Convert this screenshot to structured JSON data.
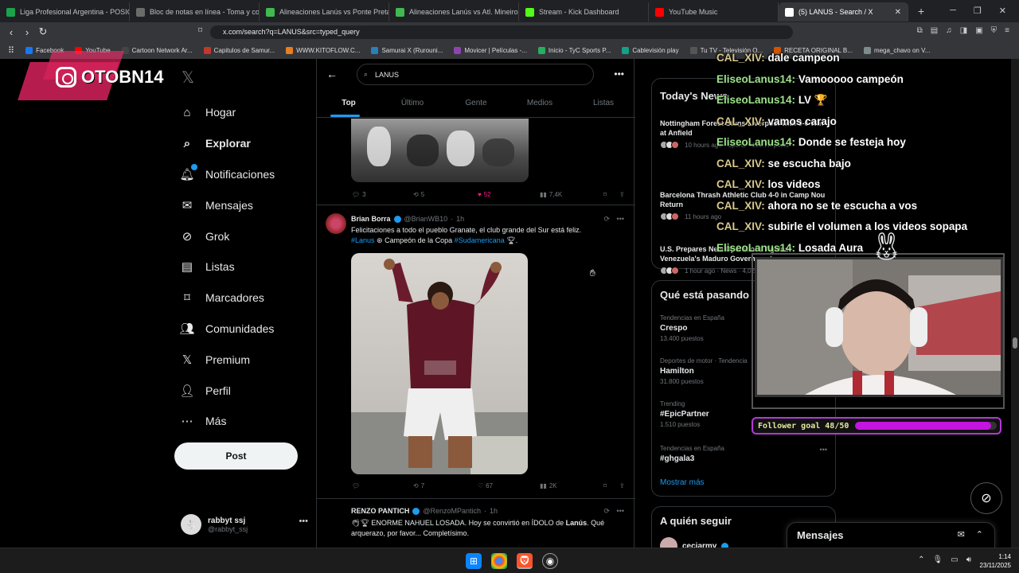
{
  "browser": {
    "tabs": [
      {
        "title": "Liga Profesional Argentina - POSICI",
        "color": "#1aa34a"
      },
      {
        "title": "Bloc de notas en línea - Toma y com",
        "color": "#6b6b6b"
      },
      {
        "title": "Alineaciones Lanús vs Ponte Preta, C",
        "color": "#3fb950"
      },
      {
        "title": "Alineaciones Lanús vs Atl. Mineiro, C",
        "color": "#3fb950"
      },
      {
        "title": "Stream - Kick Dashboard",
        "color": "#53fc18"
      },
      {
        "title": "YouTube Music",
        "color": "#ff0000"
      },
      {
        "title": "(5) LANUS - Search / X",
        "color": "#ffffff"
      }
    ],
    "url": "x.com/search?q=LANUS&src=typed_query",
    "bookmarks": [
      "Facebook",
      "YouTube",
      "Cartoon Network Ar...",
      "Capitulos de Samur...",
      "WWW.KITOFLOW.C...",
      "Samurai X (Rurouni...",
      "Movicer | Películas -...",
      "Inicio - TyC Sports P...",
      "Cablevisión play",
      "Tu TV - Televisión O...",
      "RECETA ORIGINAL B...",
      "mega_chavo on V..."
    ]
  },
  "overlay": {
    "handle": "OTOBN14"
  },
  "sidebar": {
    "items": [
      {
        "label": "Hogar",
        "icon": "home-icon"
      },
      {
        "label": "Explorar",
        "icon": "search-icon"
      },
      {
        "label": "Notificaciones",
        "icon": "bell-icon"
      },
      {
        "label": "Mensajes",
        "icon": "mail-icon"
      },
      {
        "label": "Grok",
        "icon": "grok-icon"
      },
      {
        "label": "Listas",
        "icon": "list-icon"
      },
      {
        "label": "Marcadores",
        "icon": "bookmark-icon"
      },
      {
        "label": "Comunidades",
        "icon": "communities-icon"
      },
      {
        "label": "Premium",
        "icon": "x-icon"
      },
      {
        "label": "Perfil",
        "icon": "person-icon"
      },
      {
        "label": "Más",
        "icon": "more-icon"
      }
    ],
    "post_label": "Post",
    "account": {
      "name": "rabbyt ssj",
      "handle": "@rabbyt_ssj"
    }
  },
  "search": {
    "query": "LANUS",
    "tabs": [
      "Top",
      "Último",
      "Gente",
      "Medios",
      "Listas"
    ]
  },
  "tweets": [
    {
      "stats": {
        "replies": "3",
        "retweets": "5",
        "likes": "52",
        "views": "7,4K"
      }
    },
    {
      "name": "Brian Borra",
      "handle": "@BrianWB10",
      "time": "1h",
      "text1": "Felicitaciones a todo el pueblo Granate, el club grande del Sur está feliz.",
      "hashtag1": "#Lanus",
      "text2": "Campeón de la Copa",
      "hashtag2": "#Sudamericana",
      "stats": {
        "replies": "",
        "retweets": "7",
        "likes": "67",
        "views": "2K"
      }
    },
    {
      "name": "RENZO PANTICH",
      "handle": "@RenzoMPantich",
      "time": "1h",
      "text1": "ENORME NAHUEL LOSADA. Hoy se convirtió en ÍDOLO de",
      "bold": "Lanús",
      "text2": ". Qué",
      "text3": "arquerazo, por favor... Completísimo."
    }
  ],
  "right": {
    "news_title": "Today's News",
    "news": [
      {
        "title": "Nottingham Forest Stuns Liverpool with 3-0 Win at Anfield",
        "meta": "10 hours ago · Sports · 159.7K posts"
      },
      {
        "title": "Barcelona Thrash Athletic Club 4-0 in Camp Nou Return",
        "meta": "11 hours ago"
      },
      {
        "title": "U.S. Prepares New Operations Against Venezuela's Maduro Government",
        "meta": "1 hour ago · News · 4,021 posts"
      }
    ],
    "trends_title": "Qué está pasando",
    "trends": [
      {
        "context": "Tendencias en España",
        "name": "Crespo",
        "posts": "13.400 puestos"
      },
      {
        "context": "Deportes de motor · Tendencia",
        "name": "Hamilton",
        "posts": "31.800 puestos"
      },
      {
        "context": "Trending",
        "name": "#EpicPartner",
        "posts": "1.510 puestos"
      },
      {
        "context": "Tendencias en España",
        "name": "#ghgala3",
        "posts": ""
      }
    ],
    "show_more": "Mostrar más",
    "follow_title": "A quién seguir",
    "follow_user": "ceciarmy"
  },
  "chat": [
    {
      "user": "CAL_XIV:",
      "msg": "dale campeon",
      "c": "u2"
    },
    {
      "user": "EliseoLanus14:",
      "msg": "Vamooooo campeón",
      "c": "u1"
    },
    {
      "user": "EliseoLanus14:",
      "msg": "LV 🏆",
      "c": "u1"
    },
    {
      "user": "CAL_XIV:",
      "msg": "vamos carajo",
      "c": "u2"
    },
    {
      "user": "EliseoLanus14:",
      "msg": "Donde se festeja hoy",
      "c": "u1"
    },
    {
      "user": "CAL_XIV:",
      "msg": "se escucha bajo",
      "c": "u2"
    },
    {
      "user": "CAL_XIV:",
      "msg": "los videos",
      "c": "u2"
    },
    {
      "user": "CAL_XIV:",
      "msg": "ahora no se te escucha a vos",
      "c": "u2"
    },
    {
      "user": "CAL_XIV:",
      "msg": "subirle el volumen a los videos sopapa",
      "c": "u2"
    },
    {
      "user": "EliseoLanus14:",
      "msg": "Losada Aura",
      "c": "u1"
    }
  ],
  "follower_goal": {
    "label": "Follower goal 48/50",
    "current": 48,
    "target": 50
  },
  "messages_panel": {
    "title": "Mensajes"
  },
  "taskbar": {
    "time": "1:14",
    "date": "23/11/2025"
  }
}
